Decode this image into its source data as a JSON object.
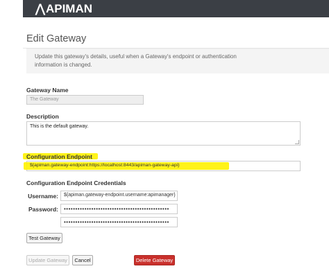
{
  "brand": {
    "logo_text": "APIMAN"
  },
  "page": {
    "title": "Edit Gateway",
    "description": "Update this gateway's details, useful when a Gateway's endpoint or authentication information is changed."
  },
  "form": {
    "name_label": "Gateway Name",
    "name_value": "The Gateway",
    "description_label": "Description",
    "description_value": "This is the default gateway.",
    "endpoint_label": "Configuration Endpoint",
    "endpoint_value": "${apiman.gateway-endpoint:https://localhost:8443/apiman-gateway-api}",
    "credentials_label": "Configuration Endpoint Credentials",
    "username_label": "Username:",
    "username_value": "${apiman.gateway-endpoint.username:apimanager}",
    "password_label": "Password:",
    "password_value": "••••••••••••••••••••••••••••••••••••••••••••••",
    "password_confirm_value": "••••••••••••••••••••••••••••••••••••••••••••••"
  },
  "buttons": {
    "test": "Test Gateway",
    "update": "Update Gateway",
    "cancel": "Cancel",
    "delete": "Delete Gateway"
  },
  "colors": {
    "header_bg": "#3b3f45",
    "highlight": "#fff200",
    "danger": "#c9302c"
  }
}
